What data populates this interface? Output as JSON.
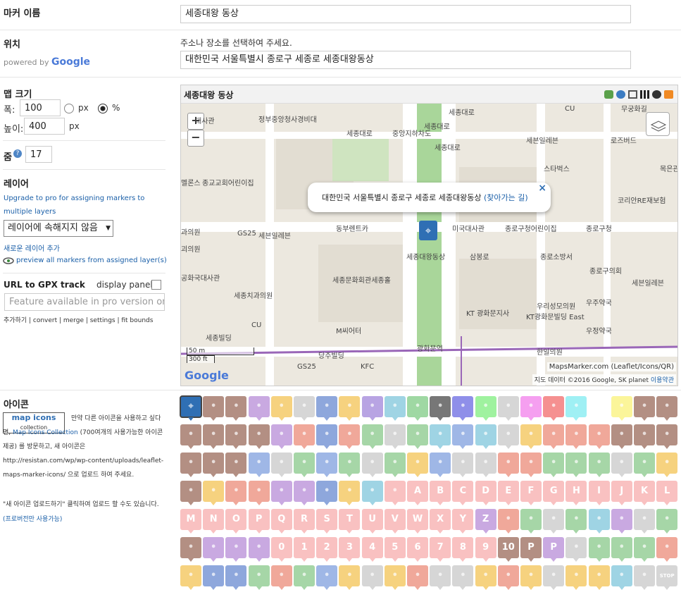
{
  "marker_name": {
    "label": "마커 이름",
    "value": "세종대왕 동상"
  },
  "location": {
    "label": "위치",
    "powered": "powered by",
    "google": "Google",
    "hint": "주소나 장소를 선택하여 주세요.",
    "value": "대한민국 서울특별시 종로구 세종로 세종대왕동상"
  },
  "map_size": {
    "label": "맵 크기",
    "width_label": "폭:",
    "width_value": "100",
    "height_label": "높이:",
    "height_value": "400",
    "unit_px": "px",
    "unit_pct": "%",
    "selected_unit": "%"
  },
  "zoom": {
    "label": "줌",
    "value": "17"
  },
  "layer": {
    "label": "레이어",
    "upgrade": "Upgrade to pro for assigning markers to multiple layers",
    "select_value": "레이어에 속해지지 않음",
    "add_layer": "새로운 레이어 추가",
    "preview": "preview all markers from assigned layer(s)"
  },
  "gpx": {
    "label": "URL to GPX track",
    "display_panel": "display panel",
    "placeholder": "Feature available in pro version only",
    "links": "추가하기 | convert | merge | settings | fit bounds"
  },
  "map": {
    "title": "세종대왕 동상",
    "popup_text": "대한민국 서울특별시 종로구 세종로 세종대왕동상",
    "popup_link": "(찾아가는 길)",
    "scale_m": "50 m",
    "scale_ft": "300 ft",
    "attribution_link": "MapsMarker.com (Leaflet/Icons/QR)",
    "attribution": "지도 데이터 ©2016 Google, SK planet",
    "terms": "이용약관",
    "labels": [
      "세종대로",
      "정부중앙청사경비대",
      "대사관",
      "세종대로",
      "중앙지하차도",
      "CU",
      "세븐일레븐",
      "로즈버드",
      "스타벅스",
      "무궁화길",
      "종교교회어린이집",
      "세종대로",
      "미국대사관",
      "종로구청어린이집",
      "종로구청",
      "GS25",
      "세븐일레븐",
      "동부렌트카",
      "세종대왕동상",
      "삼봉로",
      "종로소방서",
      "종로구의회",
      "세븐일레븐",
      "세종문화회관세종홀",
      "KT 광화문지사",
      "우리성모의원",
      "우주약국",
      "세종치과의원",
      "KT광화문빌딩 East",
      "CU",
      "M씨어터",
      "우정약국",
      "세종빌딩",
      "광화문역",
      "한일의원",
      "당주빌딩",
      "KFC",
      "GS25",
      "코리안RE재보험",
      "목은관",
      "멜론스",
      "공화국대사관",
      "괴의원",
      "과의원",
      "세종대로"
    ]
  },
  "icons": {
    "label": "아이콘",
    "collection": "collection",
    "desc1": "만약 다른 아이콘을 사용하고 싶다면,",
    "desc_link": "Map Icons Collection",
    "desc2": "(700여개의 사용가능한 아이콘 제공) 를 방문하고, 새 아이콘은 http://resistan.com/wp/wp-content/uploads/leaflet-maps-marker-icons/ 으로 업로드 하여 주세요.",
    "desc3": "\"새 아이콘 업로드하기\" 클릭하여 업로드 할 수도 있습니다.",
    "pro_note": "(프로버전만 사용가능)",
    "rows": [
      [
        "#2f6fb4",
        "#b38f83",
        "#b38f83",
        "#c9a9e1",
        "#f6d27f",
        "#d6d6d6",
        "#8ea7dc",
        "#f6d27f",
        "#b8a4e3",
        "#9fd4e4",
        "#9fd8a3",
        "#777777",
        "#8f8fe9",
        "#9ff29f",
        "#d6d6d6",
        "#f59ff0",
        "#f59090",
        "#9ff0f4",
        "#ffffff",
        "#fbf59a",
        "#b38f83",
        "#b38f83"
      ],
      [
        "#b38f83",
        "#b38f83",
        "#b38f83",
        "#b38f83",
        "#c9a9e1",
        "#f0a89a",
        "#8ea7dc",
        "#f0a89a",
        "#a6d6a7",
        "#d6d6d6",
        "#a6d6a7",
        "#9fd4e4",
        "#9fb7e6",
        "#9fd4e4",
        "#d6d6d6",
        "#f6d27f",
        "#f0a89a",
        "#f0a89a",
        "#f0a89a",
        "#b38f83",
        "#b38f83",
        "#b38f83"
      ],
      [
        "#b38f83",
        "#b38f83",
        "#b38f83",
        "#9fb7e6",
        "#d6d6d6",
        "#a6d6a7",
        "#9fb7e6",
        "#a6d6a7",
        "#d6d6d6",
        "#a6d6a7",
        "#f6d27f",
        "#9fb7e6",
        "#d6d6d6",
        "#d6d6d6",
        "#f0a89a",
        "#f0a89a",
        "#a6d6a7",
        "#a6d6a7",
        "#a6d6a7",
        "#d6d6d6",
        "#a6d6a7",
        "#f6d27f"
      ],
      [
        "#b38f83",
        "#f6d27f",
        "#f0a89a",
        "#f0a89a",
        "#c9a9e1",
        "#c9a9e1",
        "#8ea7dc",
        "#f6d27f",
        "#9fd4e4",
        "#f9c1c1",
        "#f9c1c1",
        "#f9c1c1",
        "#f9c1c1",
        "#f9c1c1",
        "#f9c1c1",
        "#f9c1c1",
        "#f9c1c1",
        "#f9c1c1",
        "#f9c1c1",
        "#f9c1c1",
        "#f9c1c1",
        "#f9c1c1"
      ],
      [
        "#f9c1c1",
        "#f9c1c1",
        "#f9c1c1",
        "#f9c1c1",
        "#f9c1c1",
        "#f9c1c1",
        "#f9c1c1",
        "#f9c1c1",
        "#f9c1c1",
        "#f9c1c1",
        "#f9c1c1",
        "#f9c1c1",
        "#f9c1c1",
        "#c9a9e1",
        "#f0a89a",
        "#a6d6a7",
        "#d6d6d6",
        "#a6d6a7",
        "#9fd4e4",
        "#c9a9e1",
        "#d6d6d6",
        "#a6d6a7"
      ],
      [
        "#b38f83",
        "#c9a9e1",
        "#c9a9e1",
        "#c9a9e1",
        "#f9c1c1",
        "#f9c1c1",
        "#f9c1c1",
        "#f9c1c1",
        "#f9c1c1",
        "#f9c1c1",
        "#f9c1c1",
        "#f9c1c1",
        "#f9c1c1",
        "#f9c1c1",
        "#b38f83",
        "#b38f83",
        "#c9a9e1",
        "#d6d6d6",
        "#a6d6a7",
        "#a6d6a7",
        "#a6d6a7",
        "#f0a89a"
      ],
      [
        "#f6d27f",
        "#8ea7dc",
        "#8ea7dc",
        "#a6d6a7",
        "#f0a89a",
        "#a6d6a7",
        "#9fb7e6",
        "#f6d27f",
        "#d6d6d6",
        "#f6d27f",
        "#f0a89a",
        "#d6d6d6",
        "#d6d6d6",
        "#f6d27f",
        "#f0a89a",
        "#f6d27f",
        "#d6d6d6",
        "#f6d27f",
        "#f6d27f",
        "#9fd4e4",
        "#d6d6d6",
        "#d6d6d6"
      ]
    ],
    "letters": [
      [
        "",
        "",
        "",
        "",
        "",
        "",
        "",
        "",
        "",
        "",
        "",
        "",
        "",
        "",
        "",
        "",
        "",
        "",
        "",
        "",
        "",
        ""
      ],
      [
        "",
        "",
        "",
        "",
        "",
        "",
        "",
        "",
        "",
        "",
        "",
        "",
        "",
        "",
        "",
        "",
        "",
        "",
        "",
        "",
        "",
        ""
      ],
      [
        "",
        "",
        "",
        "",
        "",
        "",
        "",
        "",
        "",
        "",
        "",
        "",
        "",
        "",
        "",
        "",
        "",
        "",
        "",
        "",
        "",
        ""
      ],
      [
        "",
        "",
        "",
        "",
        "",
        "",
        "",
        "",
        "",
        "",
        "A",
        "B",
        "C",
        "D",
        "E",
        "F",
        "G",
        "H",
        "I",
        "J",
        "K",
        "L"
      ],
      [
        "M",
        "N",
        "O",
        "P",
        "Q",
        "R",
        "S",
        "T",
        "U",
        "V",
        "W",
        "X",
        "Y",
        "Z",
        "",
        "",
        "",
        "",
        "",
        "",
        "",
        ""
      ],
      [
        "",
        "",
        "",
        "",
        "0",
        "1",
        "2",
        "3",
        "4",
        "5",
        "6",
        "7",
        "8",
        "9",
        "10",
        "P",
        "P",
        "",
        "",
        "",
        "",
        ""
      ],
      [
        "",
        "",
        "",
        "",
        "",
        "",
        "",
        "",
        "",
        "",
        "",
        "",
        "",
        "",
        "",
        "",
        "",
        "",
        "",
        "",
        "",
        "STOP"
      ]
    ]
  }
}
